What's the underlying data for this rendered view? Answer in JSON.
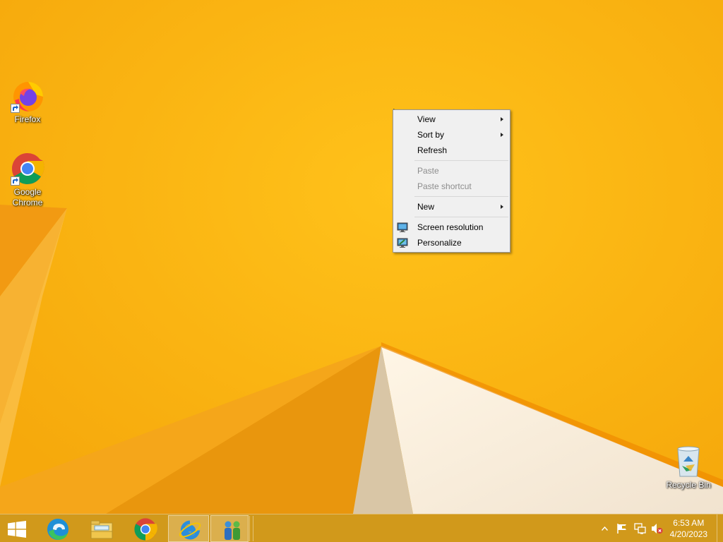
{
  "desktop": {
    "icons": [
      {
        "label": "Firefox"
      },
      {
        "label": "Google Chrome"
      },
      {
        "label": "Recycle Bin"
      }
    ]
  },
  "context_menu": {
    "items": [
      {
        "label": "View",
        "has_submenu": true,
        "enabled": true
      },
      {
        "label": "Sort by",
        "has_submenu": true,
        "enabled": true
      },
      {
        "label": "Refresh",
        "has_submenu": false,
        "enabled": true
      },
      {
        "label": "Paste",
        "has_submenu": false,
        "enabled": false
      },
      {
        "label": "Paste shortcut",
        "has_submenu": false,
        "enabled": false
      },
      {
        "label": "New",
        "has_submenu": true,
        "enabled": true
      },
      {
        "label": "Screen resolution",
        "icon": "screen-resolution-icon",
        "enabled": true
      },
      {
        "label": "Personalize",
        "icon": "personalize-icon",
        "enabled": true
      }
    ]
  },
  "taskbar": {
    "buttons": [
      {
        "icon": "windows-start-icon"
      },
      {
        "icon": "edge-icon"
      },
      {
        "icon": "file-explorer-icon"
      },
      {
        "icon": "chrome-icon"
      },
      {
        "icon": "internet-explorer-icon",
        "active": true
      },
      {
        "icon": "network-people-icon",
        "active": true
      }
    ],
    "tray": {
      "icons": [
        "show-hidden-icons-icon",
        "action-center-flag-icon",
        "network-icon",
        "volume-muted-icon"
      ],
      "time": "6:53 AM",
      "date": "4/20/2023"
    }
  },
  "colors": {
    "wallpaper_base": "#FDB913",
    "menu_background": "#F0F0F0",
    "taskbar": "#CC961E"
  }
}
